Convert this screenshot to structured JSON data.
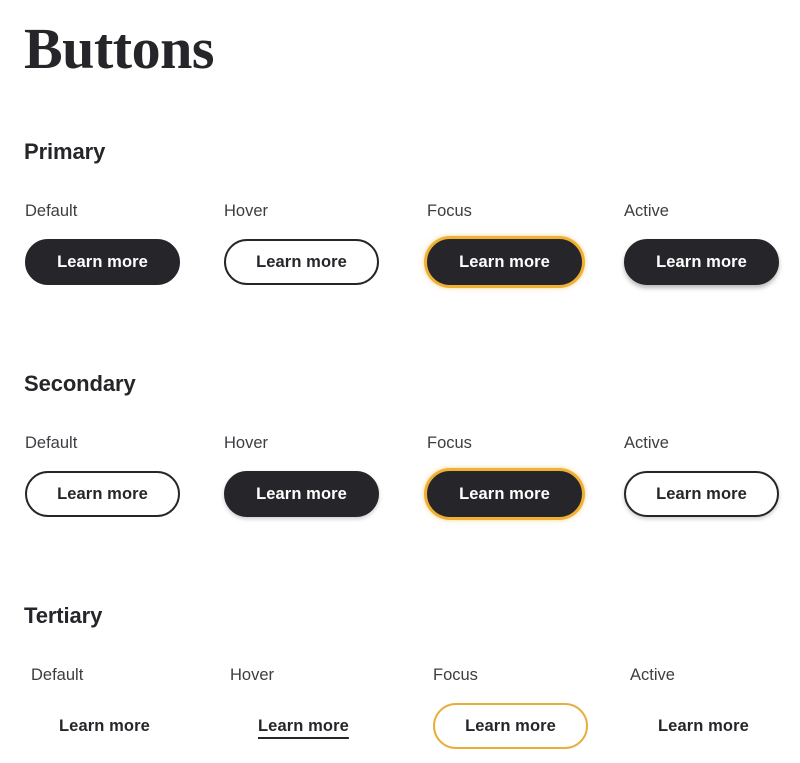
{
  "page": {
    "title": "Buttons"
  },
  "colors": {
    "dark": "#26262a",
    "surface": "#ffffff",
    "focus_gold": "#efb033",
    "focus_gold_border": "#e8ae3c",
    "label_gray": "#3d3d42"
  },
  "sections": [
    {
      "heading": "Primary",
      "states": [
        {
          "label": "Default",
          "button_label": "Learn more",
          "style": "filled"
        },
        {
          "label": "Hover",
          "button_label": "Learn more",
          "style": "outlined"
        },
        {
          "label": "Focus",
          "button_label": "Learn more",
          "style": "focus-filled"
        },
        {
          "label": "Active",
          "button_label": "Learn more",
          "style": "filled-shadow"
        }
      ]
    },
    {
      "heading": "Secondary",
      "states": [
        {
          "label": "Default",
          "button_label": "Learn more",
          "style": "outlined"
        },
        {
          "label": "Hover",
          "button_label": "Learn more",
          "style": "filled-shadow"
        },
        {
          "label": "Focus",
          "button_label": "Learn more",
          "style": "focus-filled"
        },
        {
          "label": "Active",
          "button_label": "Learn more",
          "style": "outlined-shadow"
        }
      ]
    },
    {
      "heading": "Tertiary",
      "states": [
        {
          "label": "Default",
          "button_label": "Learn more",
          "style": "text"
        },
        {
          "label": "Hover",
          "button_label": "Learn more",
          "style": "text-underline"
        },
        {
          "label": "Focus",
          "button_label": "Learn more",
          "style": "focus-outline"
        },
        {
          "label": "Active",
          "button_label": "Learn more",
          "style": "text"
        }
      ]
    }
  ]
}
